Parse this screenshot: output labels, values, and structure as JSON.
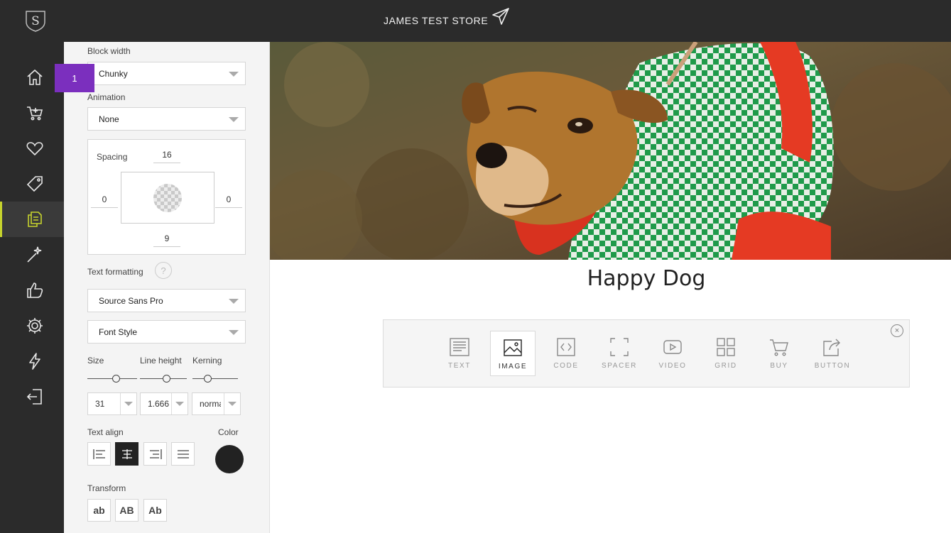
{
  "header": {
    "store_name": "JAMES TEST STORE"
  },
  "badge": {
    "label": "1",
    "color": "#7b2fbe"
  },
  "rail": {
    "items": [
      {
        "name": "home-icon"
      },
      {
        "name": "cart-icon"
      },
      {
        "name": "heart-icon"
      },
      {
        "name": "tag-icon"
      },
      {
        "name": "pages-icon",
        "active": true
      },
      {
        "name": "magic-wand-icon"
      },
      {
        "name": "thumbs-up-icon"
      },
      {
        "name": "gear-icon"
      },
      {
        "name": "lightning-icon"
      },
      {
        "name": "logout-icon"
      }
    ],
    "accent": "#c6d32d"
  },
  "panel": {
    "block_width_label": "Block width",
    "block_width_value": "Chunky",
    "animation_label": "Animation",
    "animation_value": "None",
    "spacing_label": "Spacing",
    "spacing_top": "16",
    "spacing_left": "0",
    "spacing_right": "0",
    "spacing_bottom": "9",
    "text_formatting_label": "Text formatting",
    "help_label": "?",
    "font_value": "Source Sans Pro",
    "font_style_value": "Font Style",
    "size_label": "Size",
    "line_height_label": "Line height",
    "kerning_label": "Kerning",
    "size_value": "31",
    "line_height_value": "1.666",
    "kerning_value": "normal",
    "text_align_label": "Text align",
    "color_label": "Color",
    "color_value": "#222222",
    "transform_label": "Transform",
    "transform_options": [
      "ab",
      "AB",
      "Ab"
    ]
  },
  "canvas": {
    "heading": "Happy Dog"
  },
  "block_picker": {
    "items": [
      {
        "label": "TEXT",
        "icon": "text-block-icon"
      },
      {
        "label": "IMAGE",
        "icon": "image-block-icon",
        "active": true
      },
      {
        "label": "CODE",
        "icon": "code-block-icon"
      },
      {
        "label": "SPACER",
        "icon": "spacer-block-icon"
      },
      {
        "label": "VIDEO",
        "icon": "video-block-icon"
      },
      {
        "label": "GRID",
        "icon": "grid-block-icon"
      },
      {
        "label": "BUY",
        "icon": "buy-block-icon"
      },
      {
        "label": "BUTTON",
        "icon": "button-block-icon"
      }
    ],
    "close_label": "×"
  }
}
